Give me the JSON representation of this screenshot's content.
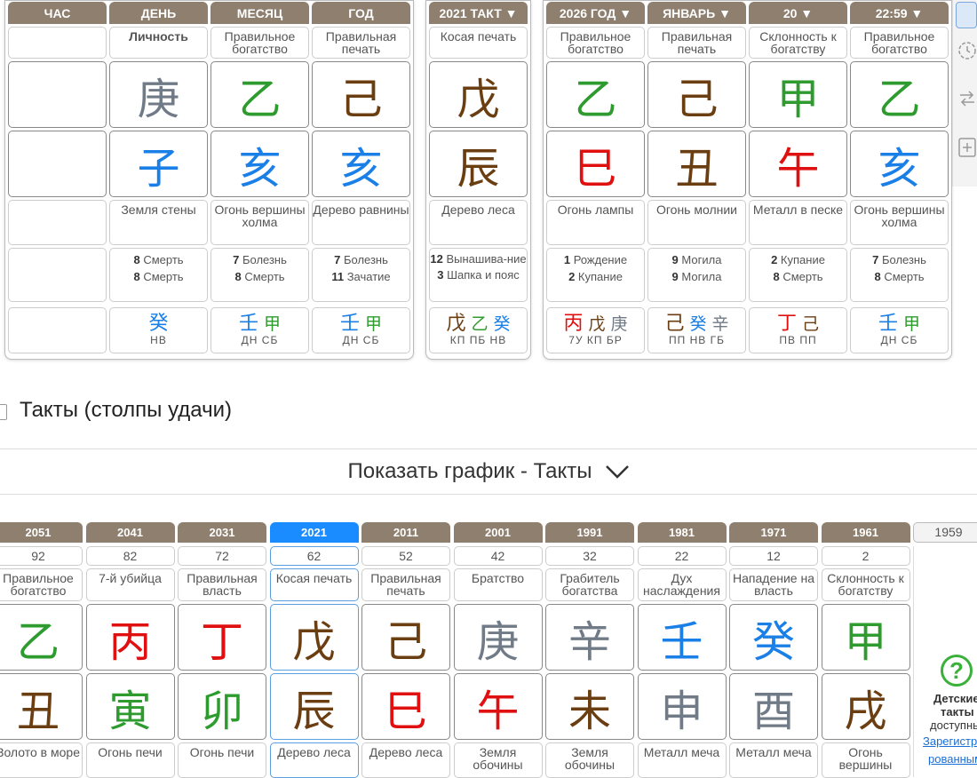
{
  "natal": {
    "headers": [
      "ЧАС",
      "ДЕНЬ",
      "МЕСЯЦ",
      "ГОД"
    ],
    "tengods": [
      "",
      "Личность",
      "Правильное богатство",
      "Правильная печать"
    ],
    "stems": [
      "",
      "庚",
      "乙",
      "己"
    ],
    "stem_colors": [
      "",
      "c-metal",
      "c-wood",
      "c-earth"
    ],
    "branches": [
      "",
      "子",
      "亥",
      "亥"
    ],
    "branch_colors": [
      "",
      "c-water",
      "c-water",
      "c-water"
    ],
    "nayin": [
      "",
      "Земля стены",
      "Огонь вершины холма",
      "Дерево равнины"
    ],
    "stages": [
      [],
      [
        [
          "8",
          "Смерть"
        ],
        [
          "8",
          "Смерть"
        ]
      ],
      [
        [
          "7",
          "Болезнь"
        ],
        [
          "8",
          "Смерть"
        ]
      ],
      [
        [
          "7",
          "Болезнь"
        ],
        [
          "11",
          "Зачатие"
        ]
      ]
    ],
    "hidden": [
      {
        "chars": [],
        "sub": ""
      },
      {
        "chars": [
          [
            "癸",
            "c-water"
          ]
        ],
        "sub": "НВ"
      },
      {
        "chars": [
          [
            "壬",
            "c-water"
          ],
          [
            "甲",
            "c-wood"
          ]
        ],
        "sub": "ДН СБ"
      },
      {
        "chars": [
          [
            "壬",
            "c-water"
          ],
          [
            "甲",
            "c-wood"
          ]
        ],
        "sub": "ДН СБ"
      }
    ]
  },
  "takt": {
    "header": "2021 ТАКТ ▼",
    "tengod": "Косая печать",
    "stem": "戊",
    "branch": "辰",
    "nayin": "Дерево леса",
    "stage1_num": "12",
    "stage1_text": "Вынашива-ние",
    "stage2_num": "3",
    "stage2_text": "Шапка и пояс",
    "hidden": [
      [
        "戊",
        "c-earth"
      ],
      [
        "乙",
        "c-wood"
      ],
      [
        "癸",
        "c-water"
      ]
    ],
    "sub": "КП ПБ НВ"
  },
  "current": {
    "headers": [
      "2026 ГОД ▼",
      "ЯНВАРЬ ▼",
      "20 ▼",
      "22:59 ▼"
    ],
    "tengods": [
      "Правильное богатство",
      "Правильная печать",
      "Склонность к богатству",
      "Правильное богатство"
    ],
    "stems": [
      "乙",
      "己",
      "甲",
      "乙"
    ],
    "stem_colors": [
      "c-wood",
      "c-earth",
      "c-wood",
      "c-wood"
    ],
    "branches": [
      "巳",
      "丑",
      "午",
      "亥"
    ],
    "branch_colors": [
      "c-fire",
      "c-earth",
      "c-fire",
      "c-water"
    ],
    "nayin": [
      "Огонь лампы",
      "Огонь молнии",
      "Металл в песке",
      "Огонь вершины холма"
    ],
    "stages": [
      [
        [
          "1",
          "Рождение"
        ],
        [
          "2",
          "Купание"
        ]
      ],
      [
        [
          "9",
          "Могила"
        ],
        [
          "9",
          "Могила"
        ]
      ],
      [
        [
          "2",
          "Купание"
        ],
        [
          "8",
          "Смерть"
        ]
      ],
      [
        [
          "7",
          "Болезнь"
        ],
        [
          "8",
          "Смерть"
        ]
      ]
    ],
    "hidden": [
      {
        "chars": [
          [
            "丙",
            "c-fire"
          ],
          [
            "戊",
            "c-earth"
          ],
          [
            "庚",
            "c-metal"
          ]
        ],
        "sub": "7У КП БР"
      },
      {
        "chars": [
          [
            "己",
            "c-earth"
          ],
          [
            "癸",
            "c-water"
          ],
          [
            "辛",
            "c-metal"
          ]
        ],
        "sub": "ПП НВ ГБ"
      },
      {
        "chars": [
          [
            "丁",
            "c-fire"
          ],
          [
            "己",
            "c-earth"
          ]
        ],
        "sub": "ПВ ПП"
      },
      {
        "chars": [
          [
            "壬",
            "c-water"
          ],
          [
            "甲",
            "c-wood"
          ]
        ],
        "sub": "ДН СБ"
      }
    ]
  },
  "section_title": "Такты (столпы удачи)",
  "chart_toggle": "Показать график - Такты",
  "pillars": {
    "years": [
      "2051",
      "2041",
      "2031",
      "2021",
      "2011",
      "2001",
      "1991",
      "1981",
      "1971",
      "1961"
    ],
    "ages": [
      "92",
      "82",
      "72",
      "62",
      "52",
      "42",
      "32",
      "22",
      "12",
      "2"
    ],
    "tengods": [
      "Правильное богатство",
      "7-й убийца",
      "Правильная власть",
      "Косая печать",
      "Правильная печать",
      "Братство",
      "Грабитель богатства",
      "Дух наслаждения",
      "Нападение на власть",
      "Склонность к богатству"
    ],
    "stems": [
      "乙",
      "丙",
      "丁",
      "戊",
      "己",
      "庚",
      "辛",
      "壬",
      "癸",
      "甲"
    ],
    "stem_colors": [
      "c-wood",
      "c-fire",
      "c-fire",
      "c-earth",
      "c-earth",
      "c-metal",
      "c-metal",
      "c-water",
      "c-water",
      "c-wood"
    ],
    "branches": [
      "丑",
      "寅",
      "卯",
      "辰",
      "巳",
      "午",
      "未",
      "申",
      "酉",
      "戌"
    ],
    "branch_colors": [
      "c-earth",
      "c-wood",
      "c-wood",
      "c-earth",
      "c-fire",
      "c-fire",
      "c-earth",
      "c-metal",
      "c-metal",
      "c-earth"
    ],
    "nayin": [
      "Золото в море",
      "Огонь печи",
      "Огонь печи",
      "Дерево леса",
      "Дерево леса",
      "Земля обочины",
      "Земля обочины",
      "Металл меча",
      "Металл меча",
      "Огонь вершины"
    ],
    "birth_year": "1959"
  },
  "kids": {
    "icon": "?",
    "title1": "Детские",
    "title2": "такты",
    "text": "доступны",
    "link1": "Зарегистр",
    "link2": "рованным"
  }
}
